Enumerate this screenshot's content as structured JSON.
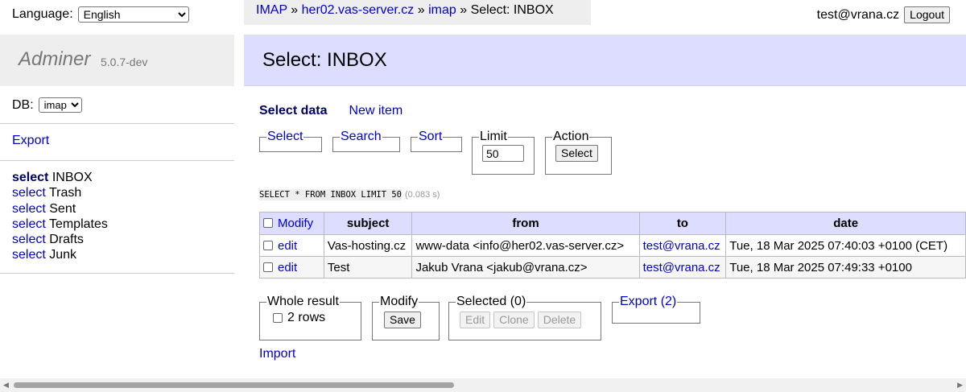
{
  "language": {
    "label": "Language:",
    "selected": "English"
  },
  "brand": {
    "name": "Adminer",
    "version": "5.0.7-dev"
  },
  "db": {
    "label": "DB:",
    "selected": "imap"
  },
  "sidebar": {
    "export_label": "Export",
    "select_word": "select",
    "tables": [
      "INBOX",
      "Trash",
      "Sent",
      "Templates",
      "Drafts",
      "Junk"
    ]
  },
  "breadcrumb": {
    "driver": "IMAP",
    "sep": "»",
    "server": "her02.vas-server.cz",
    "database": "imap",
    "current": "Select: INBOX"
  },
  "user": {
    "email": "test@vrana.cz",
    "logout_label": "Logout"
  },
  "page": {
    "title": "Select: INBOX"
  },
  "links": {
    "select_data": "Select data",
    "new_item": "New item"
  },
  "form": {
    "select_legend": "Select",
    "search_legend": "Search",
    "sort_legend": "Sort",
    "limit_legend": "Limit",
    "limit_value": "50",
    "action_legend": "Action",
    "action_button": "Select"
  },
  "query": {
    "sql": "SELECT * FROM INBOX LIMIT 50",
    "time": "(0.083 s)"
  },
  "table": {
    "modify_label": "Modify",
    "edit_label": "edit",
    "columns": [
      "subject",
      "from",
      "to",
      "date"
    ],
    "rows": [
      {
        "subject": "Vas-hosting.cz",
        "from": "www-data <info@her02.vas-server.cz>",
        "to": "test@vrana.cz",
        "date": "Tue, 18 Mar 2025 07:40:03 +0100 (CET)"
      },
      {
        "subject": "Test",
        "from": "Jakub Vrana <jakub@vrana.cz>",
        "to": "test@vrana.cz",
        "date": "Tue, 18 Mar 2025 07:49:33 +0100"
      }
    ]
  },
  "bottom": {
    "whole_result_legend": "Whole result",
    "rows_label": "2 rows",
    "modify_legend": "Modify",
    "save_button": "Save",
    "selected_legend": "Selected (0)",
    "edit_button": "Edit",
    "clone_button": "Clone",
    "delete_button": "Delete",
    "export_legend": "Export (2)"
  },
  "import_label": "Import",
  "colors": {
    "link": "#0000cc",
    "heading_bg": "#ddf",
    "sidebar_bg": "#eee"
  }
}
